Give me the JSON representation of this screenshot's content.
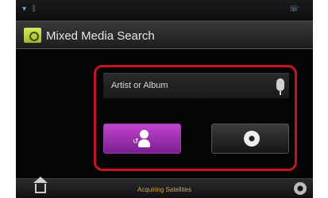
{
  "header": {
    "title": "Mixed Media Search",
    "folder_icon": "folder-search-icon"
  },
  "search": {
    "field_label": "Artist or Album",
    "mic_icon": "microphone-icon"
  },
  "buttons": {
    "artist": {
      "icon": "artist-icon"
    },
    "disc": {
      "icon": "disc-icon"
    }
  },
  "bottom_bar": {
    "status": "Acquiring Satellites",
    "home_icon": "home-icon",
    "settings_icon": "settings-icon"
  },
  "status_bar": {
    "icons": [
      "antenna-icon",
      "bluetooth-icon",
      "phone-icon"
    ]
  },
  "colors": {
    "highlight": "#c81322",
    "accent_purple": "#a332b8",
    "status_text": "#d9a93a"
  }
}
